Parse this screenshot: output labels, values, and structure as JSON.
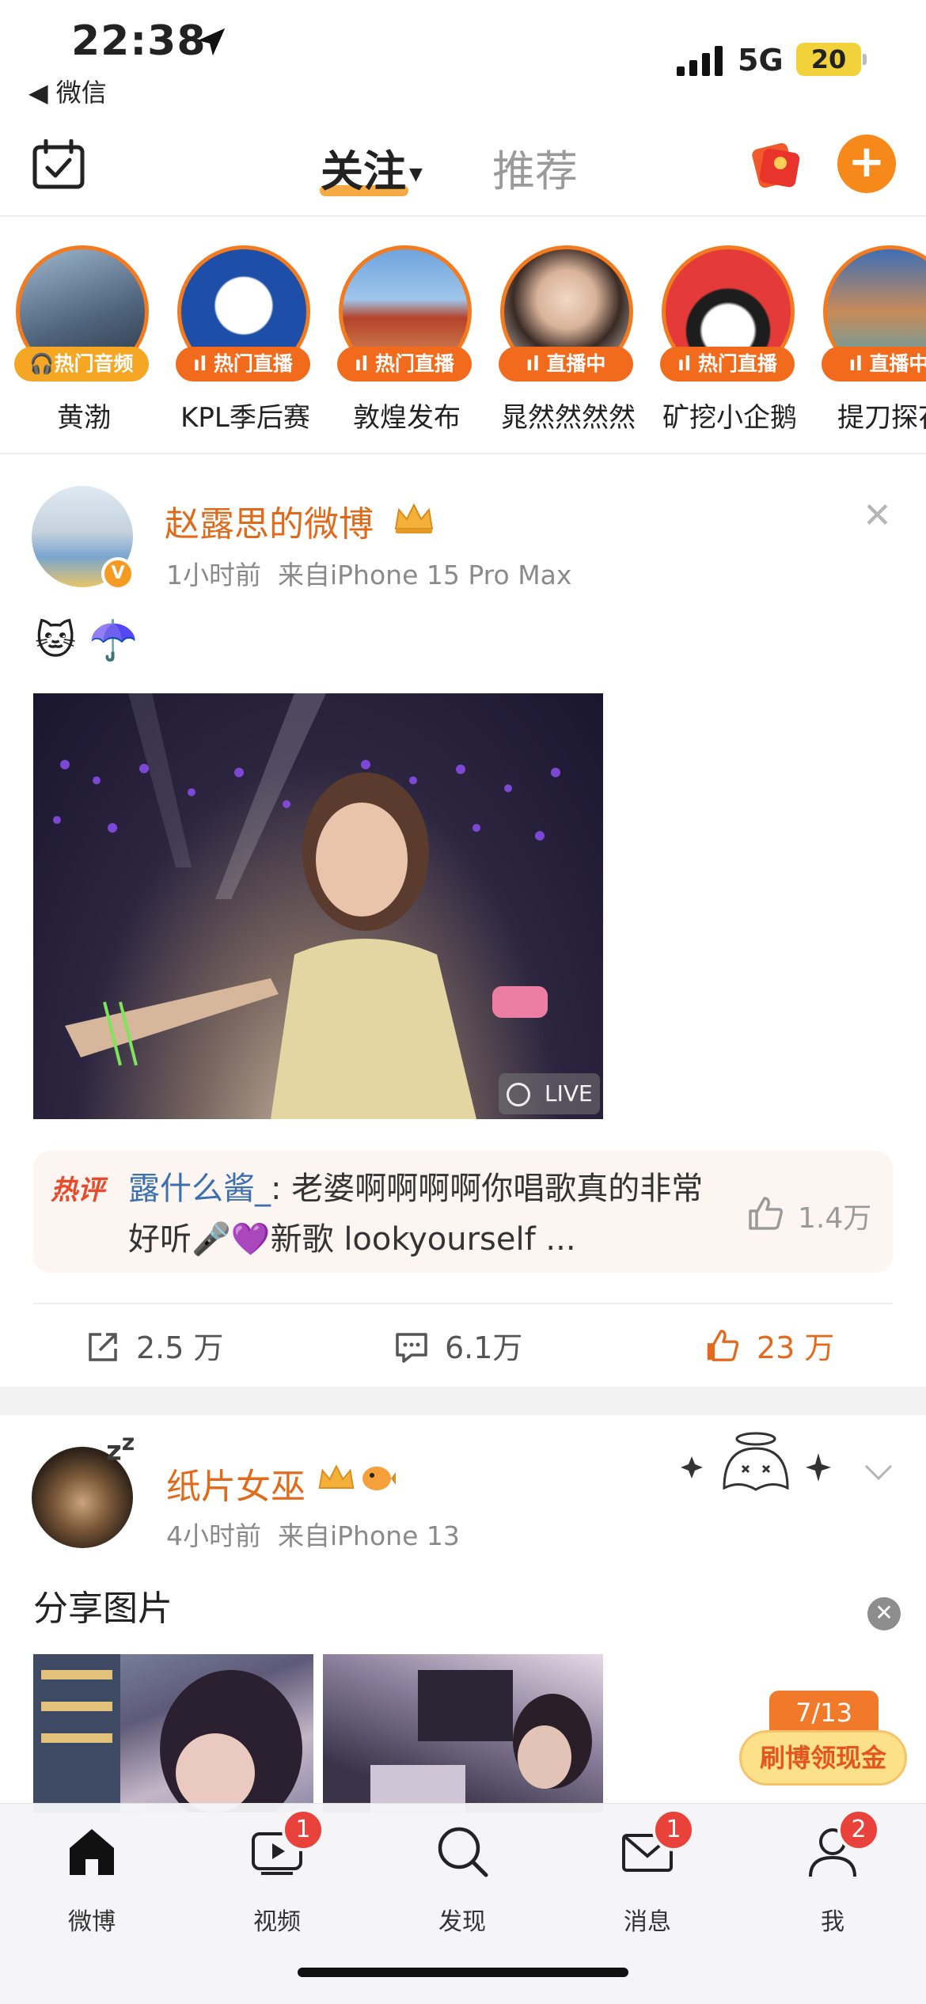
{
  "status_bar": {
    "time": "22:38",
    "back_app": "◀ 微信",
    "network": "5G",
    "battery": "20"
  },
  "top_nav": {
    "tab_follow": "关注",
    "tab_recommend": "推荐"
  },
  "stories": [
    {
      "name": "黄渤",
      "badge": "🎧热门音频",
      "badge_color": "#f5a623"
    },
    {
      "name": "KPL季后赛",
      "badge": "ıl 热门直播",
      "badge_color": "#f26a1b"
    },
    {
      "name": "敦煌发布",
      "badge": "ıl 热门直播",
      "badge_color": "#f26a1b"
    },
    {
      "name": "晁然然然然",
      "badge": "ıl 直播中",
      "badge_color": "#f26a1b"
    },
    {
      "name": "矿挖小企鹅",
      "badge": "ıl 热门直播",
      "badge_color": "#f26a1b"
    },
    {
      "name": "提刀探花",
      "badge": "ıl 直播中",
      "badge_color": "#f26a1b"
    }
  ],
  "post1": {
    "author": "赵露思的微博",
    "time": "1小时前",
    "source": "来自iPhone 15 Pro Max",
    "text": "🐱 ☂️",
    "photo_label": "LIVE",
    "hot_comment": {
      "tag": "热评",
      "user": "露什么酱_",
      "text": ": 老婆啊啊啊啊你唱歌真的非常好听🎤💜新歌 lookyourself ...",
      "likes": "1.4万"
    },
    "reposts": "2.5 万",
    "comments": "6.1万",
    "likes": "23 万"
  },
  "post2": {
    "author": "纸片女巫",
    "time": "4小时前",
    "source": "来自iPhone 13",
    "text": "分享图片"
  },
  "reward": {
    "count": "7/13",
    "label": "刷博领现金"
  },
  "tab_bar": [
    {
      "label": "微博",
      "badge": ""
    },
    {
      "label": "视频",
      "badge": "1"
    },
    {
      "label": "发现",
      "badge": ""
    },
    {
      "label": "消息",
      "badge": "1"
    },
    {
      "label": "我",
      "badge": "2"
    }
  ],
  "colors": {
    "accent": "#f7891a",
    "name": "#e06a1b",
    "badge": "#e8423a"
  }
}
